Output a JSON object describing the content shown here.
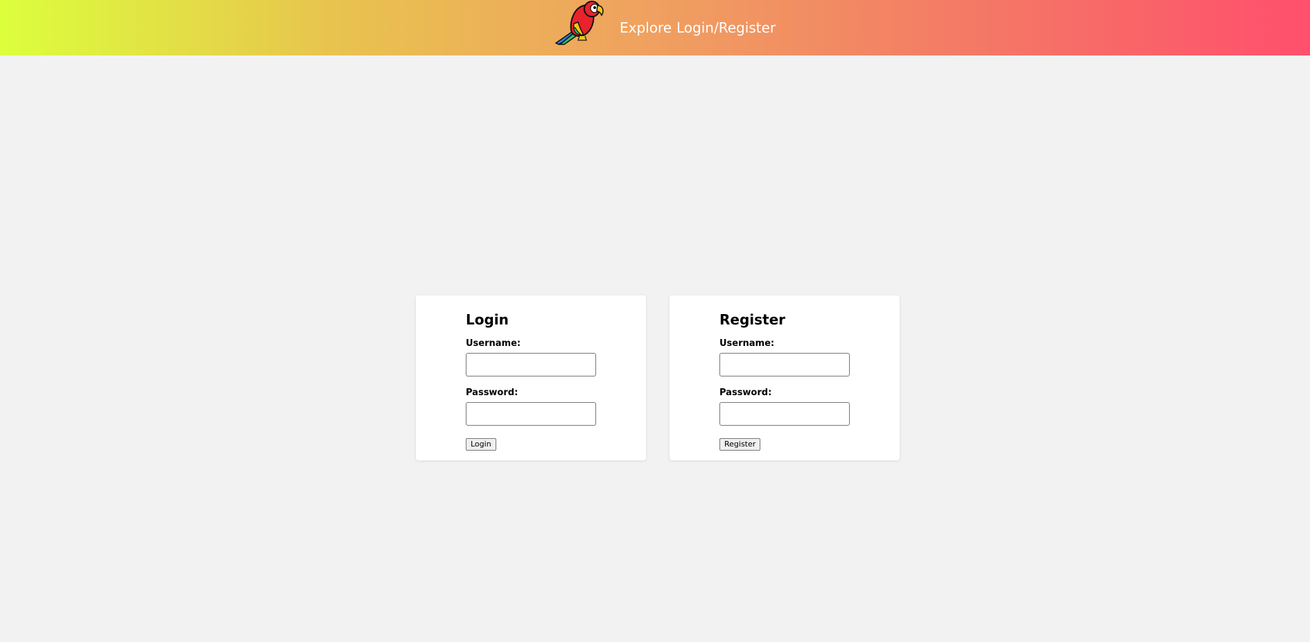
{
  "header": {
    "logo_icon": "parrot-icon",
    "nav": {
      "explore": "Explore",
      "login_register": "Login/Register"
    }
  },
  "login": {
    "title": "Login",
    "username_label": "Username:",
    "password_label": "Password:",
    "username_value": "",
    "password_value": "",
    "button_label": "Login"
  },
  "register": {
    "title": "Register",
    "username_label": "Username:",
    "password_label": "Password:",
    "username_value": "",
    "password_value": "",
    "button_label": "Register"
  },
  "colors": {
    "header_gradient_start": "#dcff3c",
    "header_gradient_end": "#ff4f6c",
    "page_background": "#f2f2f2",
    "card_background": "#ffffff"
  }
}
